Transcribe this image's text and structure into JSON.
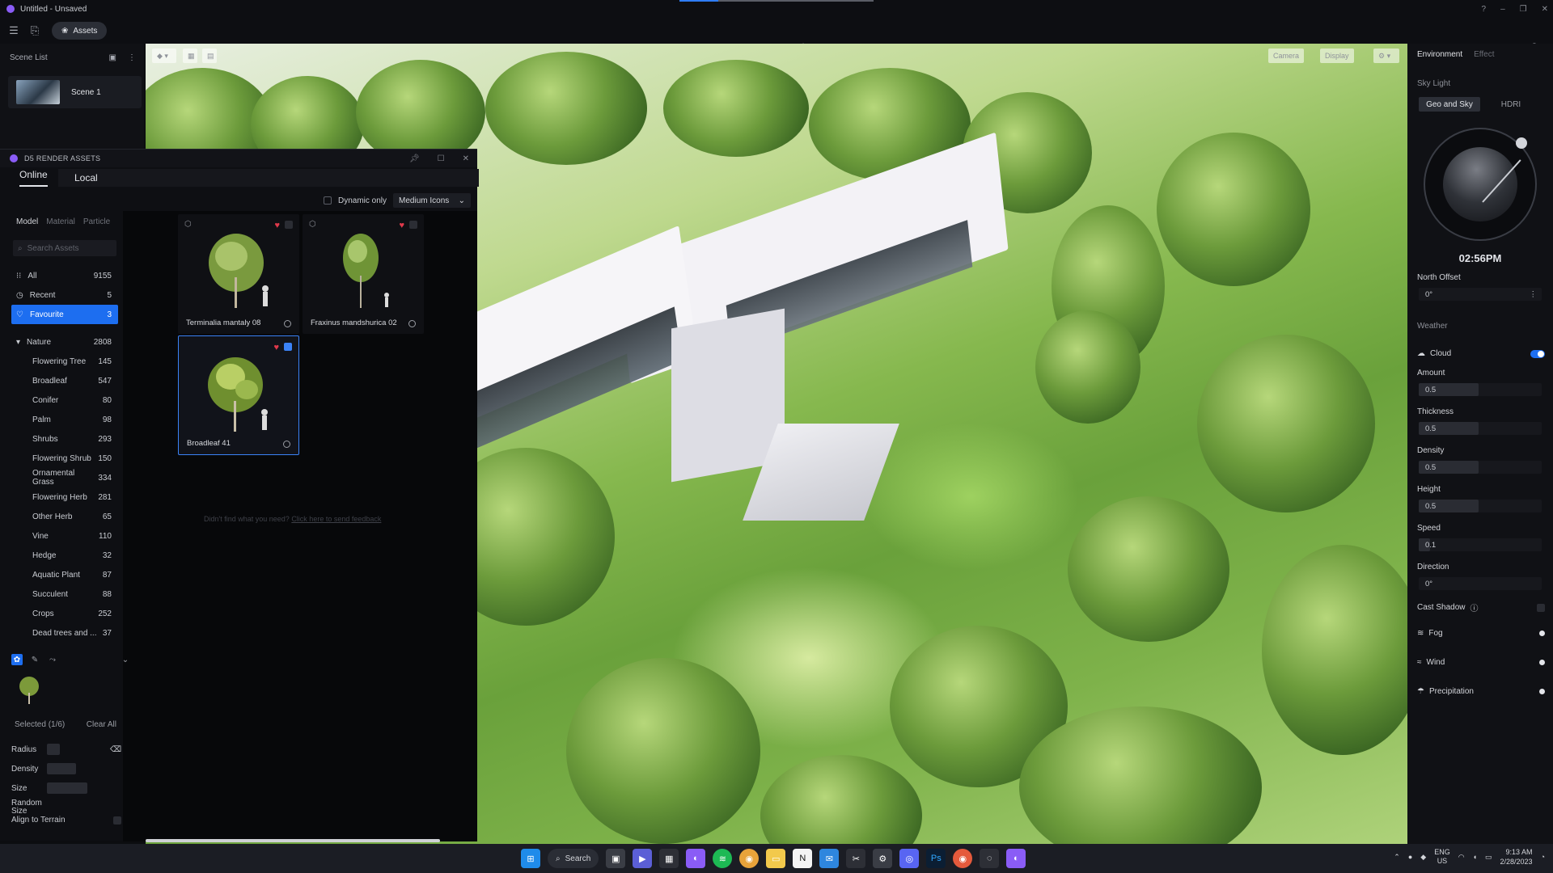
{
  "window": {
    "title": "Untitled - Unsaved"
  },
  "toolbar": {
    "assets_label": "Assets"
  },
  "scene_list": {
    "header": "Scene List",
    "scenes": [
      {
        "name": "Scene 1"
      }
    ]
  },
  "viewport": {
    "controls": [
      "Camera",
      "Display"
    ]
  },
  "assets_panel": {
    "title": "D5 RENDER ASSETS",
    "tabs": [
      "Online",
      "Local"
    ],
    "dynamic_only_label": "Dynamic only",
    "icon_size": "Medium Icons",
    "categories": [
      "Model",
      "Material",
      "Particle"
    ],
    "search_placeholder": "Search Assets",
    "items": [
      {
        "label": "All",
        "count": "9155"
      },
      {
        "label": "Recent",
        "count": "5"
      },
      {
        "label": "Favourite",
        "count": "3"
      },
      {
        "label": "Nature",
        "count": "2808"
      },
      {
        "label": "Flowering Tree",
        "count": "145"
      },
      {
        "label": "Broadleaf",
        "count": "547"
      },
      {
        "label": "Conifer",
        "count": "80"
      },
      {
        "label": "Palm",
        "count": "98"
      },
      {
        "label": "Shrubs",
        "count": "293"
      },
      {
        "label": "Flowering Shrub",
        "count": "150"
      },
      {
        "label": "Ornamental Grass",
        "count": "334"
      },
      {
        "label": "Flowering Herb",
        "count": "281"
      },
      {
        "label": "Other Herb",
        "count": "65"
      },
      {
        "label": "Vine",
        "count": "110"
      },
      {
        "label": "Hedge",
        "count": "32"
      },
      {
        "label": "Aquatic Plant",
        "count": "87"
      },
      {
        "label": "Succulent",
        "count": "88"
      },
      {
        "label": "Crops",
        "count": "252"
      },
      {
        "label": "Dead trees and ...",
        "count": "37"
      }
    ],
    "cards": [
      {
        "name": "Terminalia mantaly 08"
      },
      {
        "name": "Fraxinus mandshurica 02"
      },
      {
        "name": "Broadleaf 41"
      }
    ],
    "feedback_text": "Didn't find what you need?",
    "feedback_link": "Click here to send feedback",
    "selected_label": "Selected (1/6)",
    "clear_all": "Clear All",
    "params": [
      {
        "label": "Radius"
      },
      {
        "label": "Density"
      },
      {
        "label": "Size"
      },
      {
        "label": "Random Size"
      }
    ],
    "align_label": "Align to Terrain"
  },
  "right_panel": {
    "tabs": [
      "Environment",
      "Effect"
    ],
    "sky_light": "Sky Light",
    "sky_modes": [
      "Geo and Sky",
      "HDRI"
    ],
    "time": "02:56PM",
    "north_offset_label": "North Offset",
    "north_offset_value": "0°",
    "weather_label": "Weather",
    "cloud_label": "Cloud",
    "cloud_params": [
      {
        "label": "Amount",
        "value": "0.5"
      },
      {
        "label": "Thickness",
        "value": "0.5"
      },
      {
        "label": "Density",
        "value": "0.5"
      },
      {
        "label": "Height",
        "value": "0.5"
      },
      {
        "label": "Speed",
        "value": "0.1"
      },
      {
        "label": "Direction",
        "value": "0°"
      }
    ],
    "cast_shadow_label": "Cast Shadow",
    "fog_label": "Fog",
    "wind_label": "Wind",
    "precipitation_label": "Precipitation"
  },
  "taskbar": {
    "search_label": "Search",
    "lang": "ENG",
    "region": "US",
    "time": "9:13 AM",
    "date": "2/28/2023"
  },
  "colors": {
    "accent": "#1d6ef0",
    "favourite": "#e0394b",
    "brand": "#8a5cf6"
  }
}
